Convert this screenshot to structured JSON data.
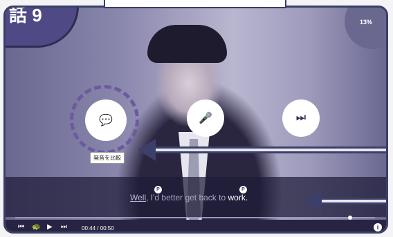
{
  "lesson": {
    "label": "話 9"
  },
  "progress": {
    "percent_label": "13%",
    "value": 0.13
  },
  "buttons": {
    "compare_icon": "chat-bubbles-icon",
    "record_icon": "microphone-icon",
    "next_icon": "skip-next-icon",
    "compare_tooltip": "発音を比較"
  },
  "subtitle": {
    "w1": "Well",
    "w2": ", I'd better get back to",
    "w3": "work."
  },
  "player": {
    "time": "00:44 / 00:50",
    "position": 0.88
  },
  "colors": {
    "accent": "#4f4a86",
    "dark": "#272443"
  }
}
